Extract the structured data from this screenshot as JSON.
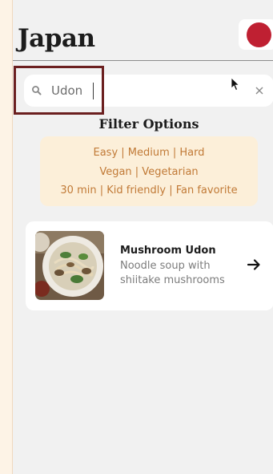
{
  "header": {
    "title": "Japan",
    "flag_color": "#bf2032",
    "flag_icon": "japan-flag-icon"
  },
  "search": {
    "value": "Udon",
    "placeholder": "",
    "search_icon": "search-icon",
    "clear_icon": "close-icon"
  },
  "filters": {
    "title": "Filter Options",
    "lines": [
      "Easy | Medium | Hard",
      "Vegan | Vegetarian",
      "30 min | Kid friendly | Fan favorite"
    ]
  },
  "results": [
    {
      "name": "Mushroom Udon",
      "description": "Noodle soup with shiitake mushrooms",
      "action_icon": "arrow-right-icon"
    }
  ],
  "colors": {
    "accent_filter_bg": "#fcefd9",
    "accent_filter_text": "#c17a37",
    "focus_outline": "#6b1f1f"
  }
}
